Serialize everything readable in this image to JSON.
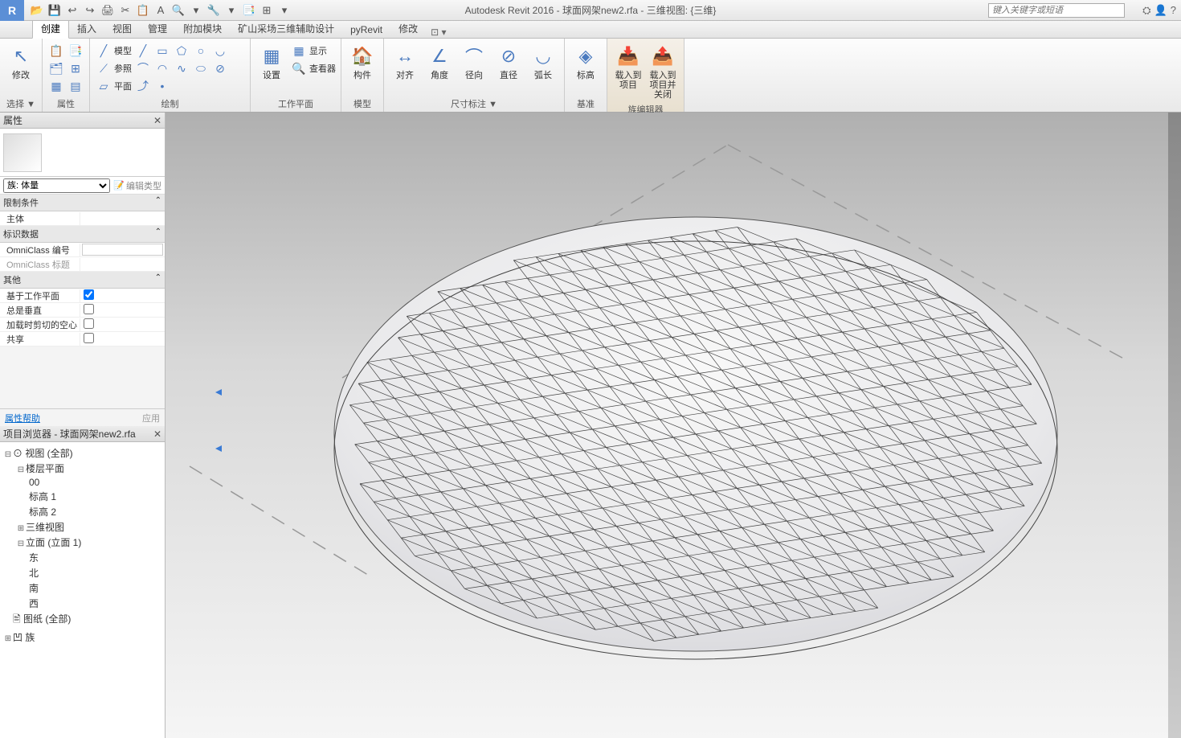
{
  "title": "Autodesk Revit 2016 -     球面网架new2.rfa - 三维视图: {三维}",
  "search_placeholder": "键入关键字或短语",
  "qat": [
    "📂",
    "💾",
    "↩",
    "↪",
    "🖨",
    "✂",
    "📋",
    "A",
    "🔍",
    "▾",
    "🔧",
    "▾",
    "📑",
    "⊞",
    "▾"
  ],
  "tabs": [
    "创建",
    "插入",
    "视图",
    "管理",
    "附加模块",
    "矿山采场三维辅助设计",
    "pyRevit",
    "修改"
  ],
  "active_tab": 0,
  "ribbon": {
    "select": {
      "title": "选择 ▼",
      "modify": "修改"
    },
    "properties": {
      "title": "属性"
    },
    "draw": {
      "title": "绘制",
      "model": "模型",
      "ref": "参照",
      "plane": "平面"
    },
    "workplane": {
      "title": "工作平面",
      "set": "设置",
      "show": "显示",
      "viewer": "查看器"
    },
    "model": {
      "title": "模型",
      "component": "构件"
    },
    "dimension": {
      "title": "尺寸标注 ▼",
      "align": "对齐",
      "angle": "角度",
      "radial": "径向",
      "diameter": "直径",
      "arc": "弧长"
    },
    "datum": {
      "title": "基准",
      "level": "标高"
    },
    "family": {
      "title": "族编辑器",
      "load": "载入到\n项目",
      "loadclose": "载入到\n项目并关闭"
    }
  },
  "props_panel": {
    "title": "属性",
    "family_type": "族: 体量",
    "edit_type": "编辑类型",
    "section_constraint": "限制条件",
    "host": "主体",
    "section_identity": "标识数据",
    "omni_num": "OmniClass 编号",
    "omni_title": "OmniClass 标题",
    "section_other": "其他",
    "workplane_based": "基于工作平面",
    "always_vertical": "总是垂直",
    "cut_with_voids": "加载时剪切的空心",
    "shared": "共享",
    "help": "属性帮助",
    "apply": "应用"
  },
  "browser": {
    "title": "项目浏览器 - 球面网架new2.rfa",
    "views": "视图 (全部)",
    "floor_plans": "楼层平面",
    "fp_00": "00",
    "fp_l1": "标高 1",
    "fp_l2": "标高 2",
    "views_3d": "三维视图",
    "elevations": "立面 (立面 1)",
    "e_east": "东",
    "e_north": "北",
    "e_south": "南",
    "e_west": "西",
    "sheets": "图纸 (全部)",
    "families": "族"
  }
}
